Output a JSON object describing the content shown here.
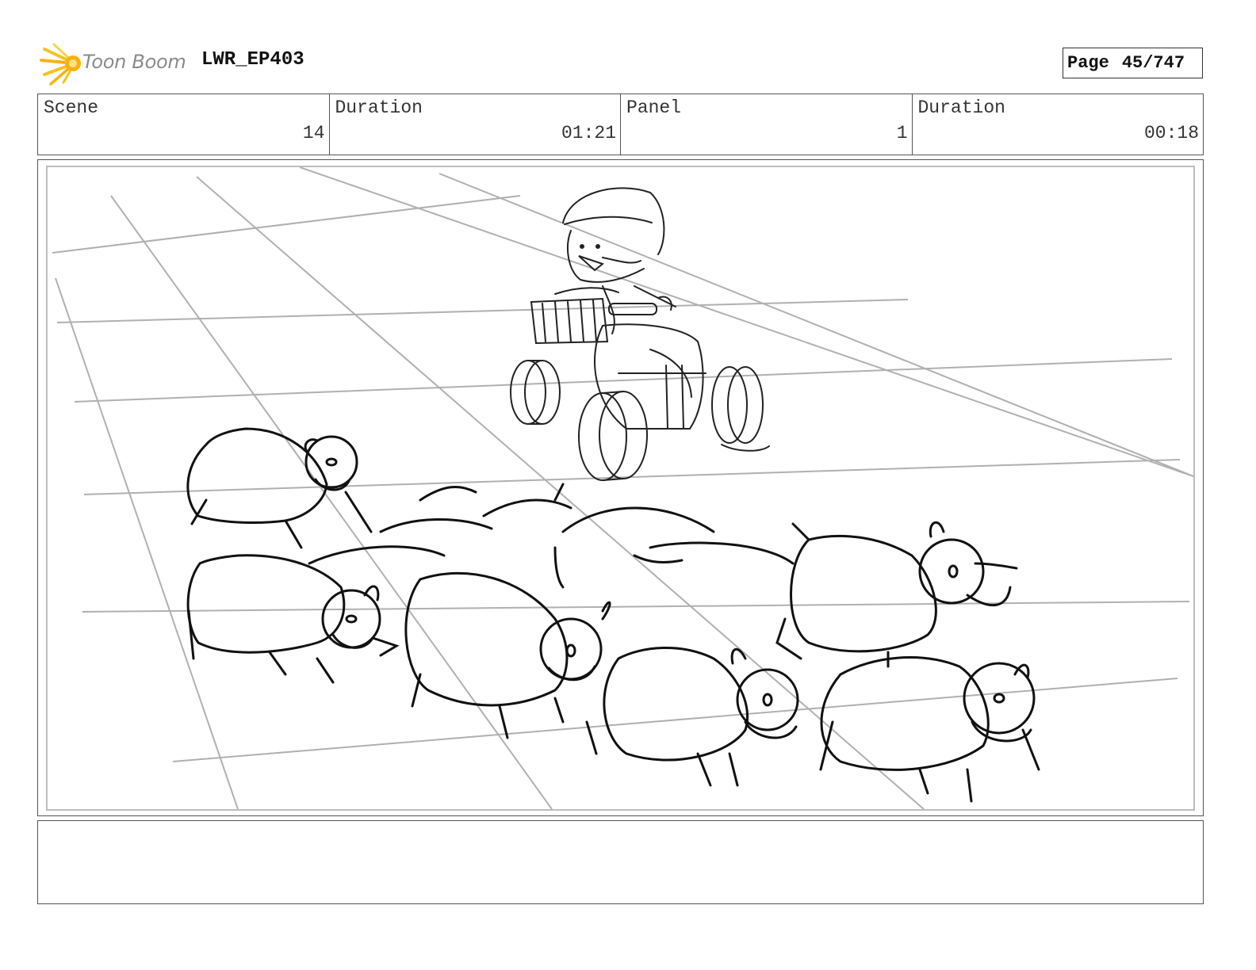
{
  "header": {
    "logo_text": "Toon Boom",
    "project_title": "LWR_EP403",
    "page_label": "Page",
    "page_value": "45/747"
  },
  "info": {
    "scene_label": "Scene",
    "scene_value": "14",
    "scene_duration_label": "Duration",
    "scene_duration_value": "01:21",
    "panel_label": "Panel",
    "panel_value": "1",
    "panel_duration_label": "Duration",
    "panel_duration_value": "00:18"
  },
  "panel": {
    "illustration": "sketch of a rider on a quad bike behind a flock of sheep on a perspective grid"
  },
  "notes": {
    "text": ""
  }
}
